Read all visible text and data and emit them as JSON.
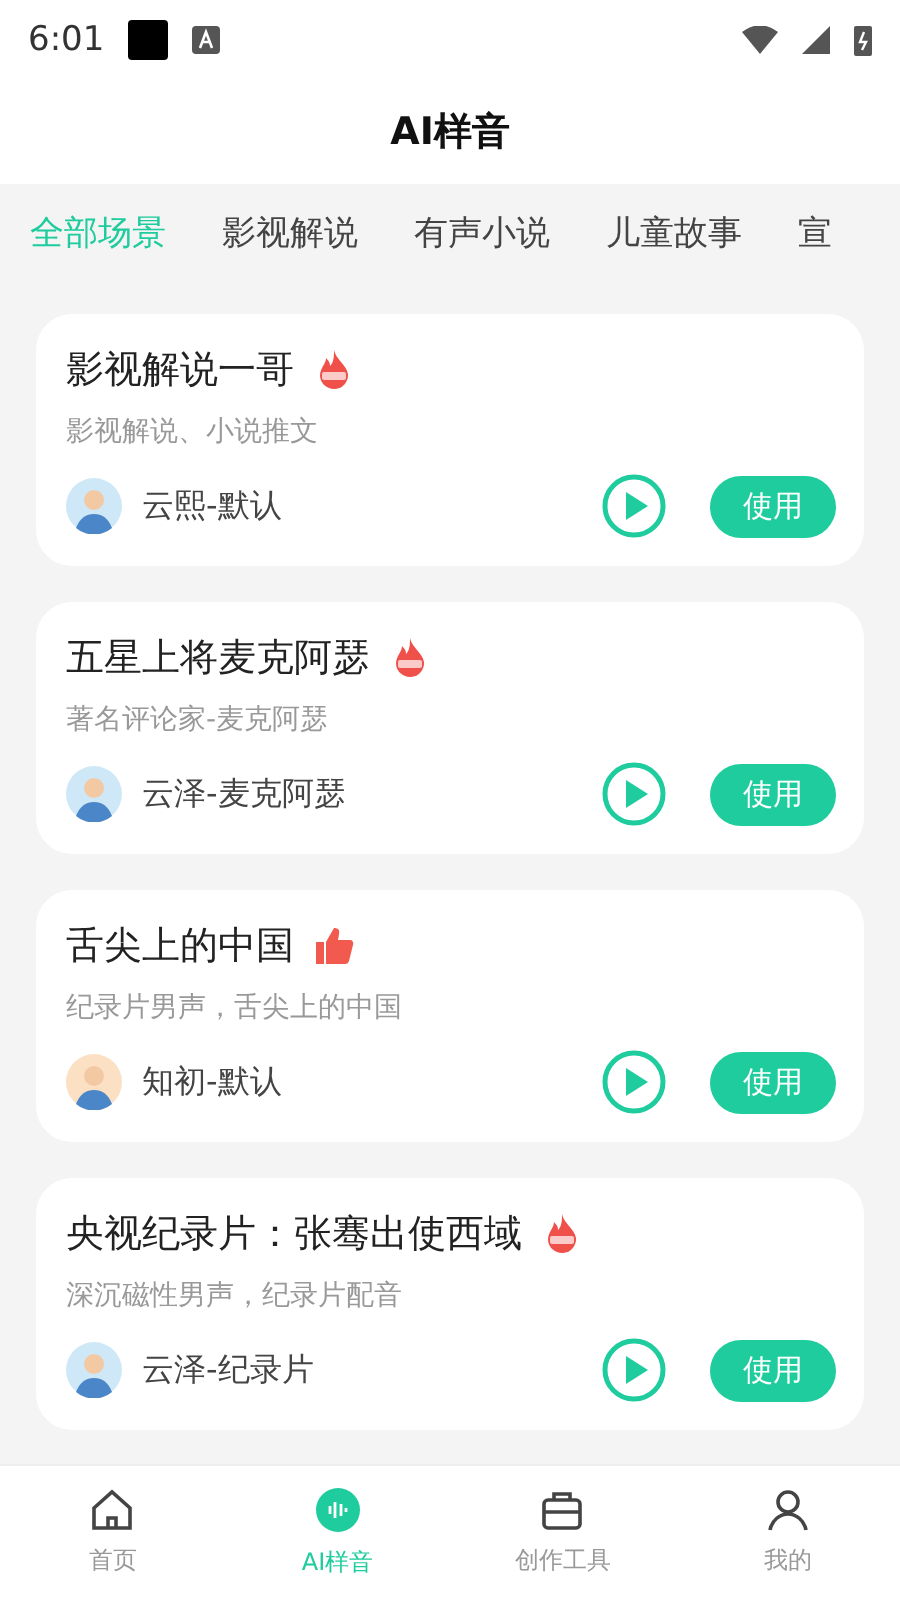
{
  "status_bar": {
    "time": "6:01"
  },
  "header": {
    "title": "AI样音"
  },
  "tabs": [
    {
      "label": "全部场景",
      "selected": true
    },
    {
      "label": "影视解说",
      "selected": false
    },
    {
      "label": "有声小说",
      "selected": false
    },
    {
      "label": "儿童故事",
      "selected": false
    },
    {
      "label": "宣",
      "selected": false
    }
  ],
  "voices": [
    {
      "title": "影视解说一哥",
      "kind": "hot",
      "description": "影视解说、小说推文",
      "speaker": "云熙-默认",
      "color": "#cfe8f8",
      "action": "使用"
    },
    {
      "title": "五星上将麦克阿瑟",
      "kind": "hot",
      "description": "著名评论家-麦克阿瑟",
      "speaker": "云泽-麦克阿瑟",
      "color": "#cfe8f8",
      "action": "使用"
    },
    {
      "title": "舌尖上的中国",
      "kind": "like",
      "description": "纪录片男声，舌尖上的中国",
      "speaker": "知初-默认",
      "color": "#fbe0c4",
      "action": "使用"
    },
    {
      "title": "央视纪录片：张骞出使西域",
      "kind": "hot",
      "description": "深沉磁性男声，纪录片配音",
      "speaker": "云泽-纪录片",
      "color": "#cfe8f8",
      "action": "使用"
    }
  ],
  "nav": [
    {
      "label": "首页",
      "kind": "home",
      "selected": false
    },
    {
      "label": "AI样音",
      "kind": "voice",
      "selected": true
    },
    {
      "label": "创作工具",
      "kind": "tools",
      "selected": false
    },
    {
      "label": "我的",
      "kind": "profile",
      "selected": false
    }
  ]
}
